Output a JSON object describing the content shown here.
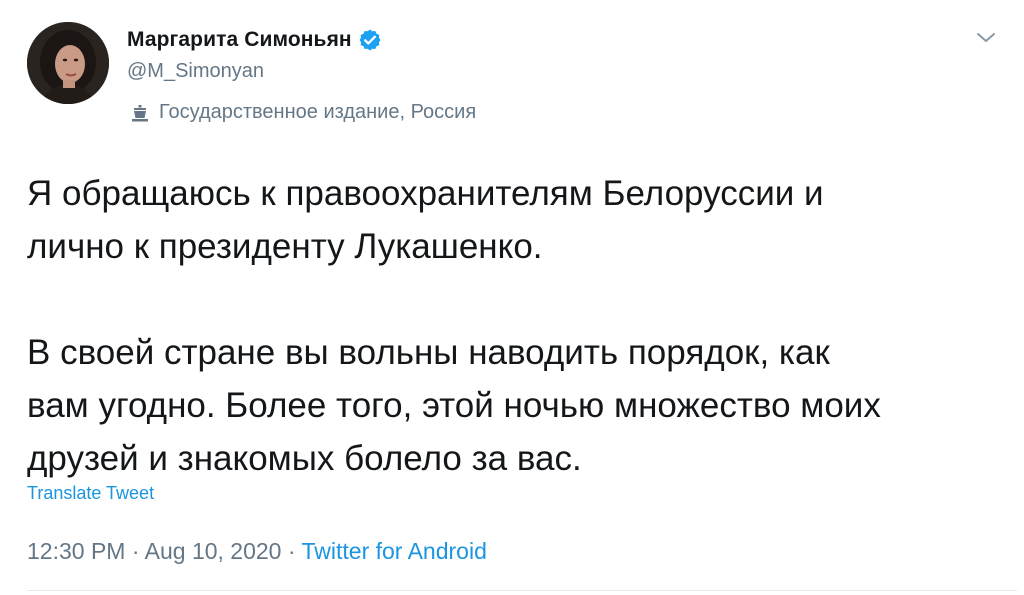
{
  "author": {
    "display_name": "Маргарита Симоньян",
    "handle": "@M_Simonyan",
    "label": "Государственное издание, Россия"
  },
  "tweet": {
    "paragraphs": [
      "Я обращаюсь к правоохранителям Белоруссии и\nлично к президенту Лукашенко.",
      "В своей стране вы вольны наводить порядок, как\nвам угодно. Более того, этой ночью множество моих\nдрузей и знакомых болело за вас."
    ],
    "translate_label": "Translate Tweet",
    "time": "12:30 PM",
    "separator": " · ",
    "date": "Aug 10, 2020",
    "source": "Twitter for Android"
  },
  "icons": {
    "verified": "verified-badge-icon",
    "label": "government-building-icon",
    "caret": "chevron-down-icon"
  },
  "colors": {
    "text": "#14171a",
    "secondary": "#657786",
    "link": "#1b95e0",
    "verified": "#1da1f2"
  }
}
